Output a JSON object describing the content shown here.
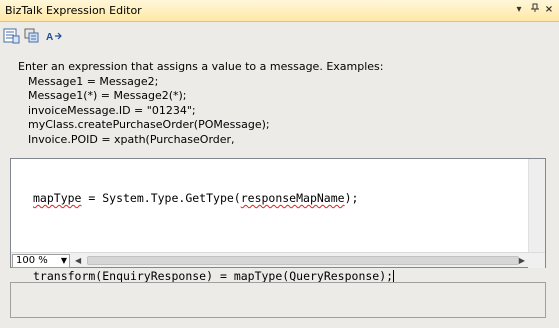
{
  "window": {
    "title": "BizTalk Expression Editor",
    "pin_icon": "dropdown-arrow-icon",
    "close_icon": "close-icon"
  },
  "toolbar": {
    "icons": [
      "list-members-icon",
      "parameter-info-icon",
      "word-completion-icon"
    ]
  },
  "instructions": {
    "intro": "Enter an expression that assigns a value to a message.  Examples:",
    "examples": [
      "Message1 = Message2;",
      "Message1(*) = Message2(*);",
      "invoiceMessage.ID = \"01234\";",
      "myClass.createPurchaseOrder(POMessage);",
      "Invoice.POID = xpath(PurchaseOrder,"
    ]
  },
  "editor": {
    "line1": {
      "a": "mapType",
      "b": " = System.Type.GetType(",
      "c": "responseMapName",
      "d": ");"
    },
    "line2": {
      "a": "transform(",
      "b": "EnquiryResponse",
      "c": ") = ",
      "d": "mapType",
      "e": "(",
      "f": "QueryResponse",
      "g": ");"
    },
    "zoom": "100 %"
  }
}
